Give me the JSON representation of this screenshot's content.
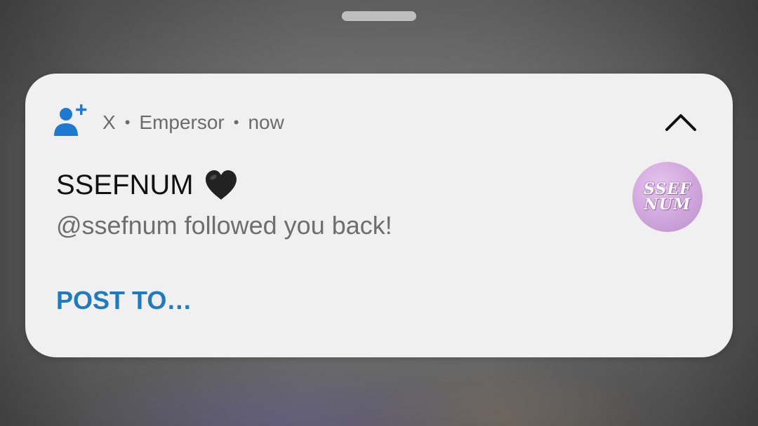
{
  "notification": {
    "app_name": "X",
    "account": "Empersor",
    "time": "now",
    "separator": "•",
    "title": "SSEFNUM",
    "message": "@ssefnum followed you back!",
    "action_label": "POST TO…",
    "avatar_text": "SSEF NUM",
    "icons": {
      "app": "person-add-icon",
      "emoji": "black-heart-icon",
      "collapse": "chevron-up-icon"
    }
  },
  "colors": {
    "card_background": "#f0f0f0",
    "title": "#111111",
    "secondary_text": "#6b6b6b",
    "action": "#1f7bbf",
    "app_icon": "#1e7ad0"
  }
}
